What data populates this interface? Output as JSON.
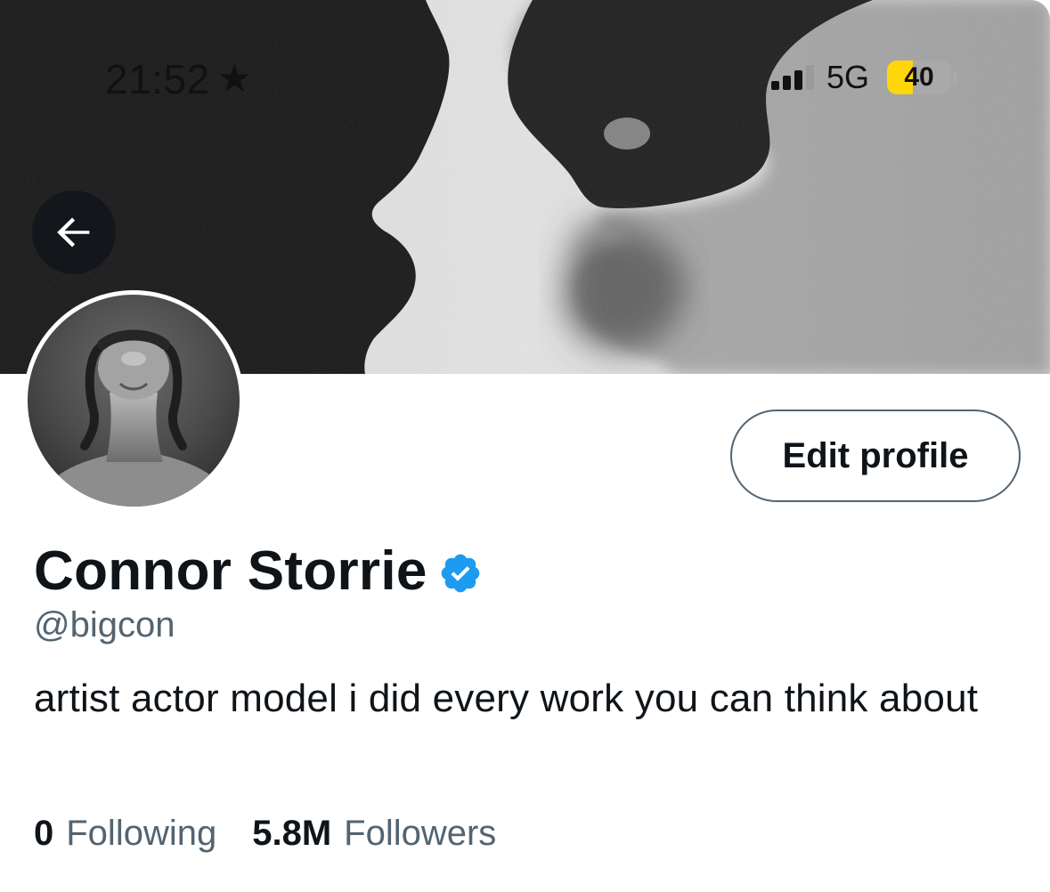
{
  "status_bar": {
    "time": "21:52",
    "focus_icon": "star-icon",
    "network": "5G",
    "battery_level": "40",
    "battery_fraction": 0.4,
    "signal_bars_active": 3,
    "signal_bars_total": 4
  },
  "header": {
    "back_icon": "arrow-left-icon",
    "banner_image": "black-and-white photo of two face silhouettes almost kissing"
  },
  "profile": {
    "avatar_image": "black-and-white portrait looking upward",
    "edit_button_label": "Edit profile",
    "display_name": "Connor Storrie",
    "verified_icon": "verified-badge-icon",
    "handle": "@bigcon",
    "bio": "artist actor model i did every work you can think about",
    "following_count": "0",
    "following_label": "Following",
    "followers_count": "5.8M",
    "followers_label": "Followers"
  },
  "colors": {
    "primary_text": "#0f1419",
    "secondary_text": "#536471",
    "verified_blue": "#1d9bf0",
    "battery_yellow": "#ffd60a"
  }
}
